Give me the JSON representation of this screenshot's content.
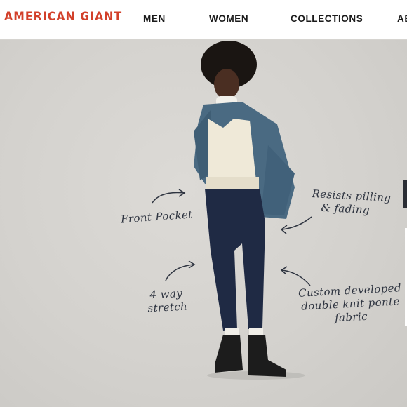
{
  "brand": {
    "logo_text": "AMERICAN GIANT",
    "accent": "#d2402a"
  },
  "nav": {
    "items": [
      {
        "label": "MEN"
      },
      {
        "label": "WOMEN"
      },
      {
        "label": "COLLECTIONS"
      },
      {
        "label": "AB"
      }
    ]
  },
  "hero": {
    "background": "#d6d4d0",
    "callouts": {
      "front_pocket": "Front Pocket",
      "resists_line1": "Resists pilling",
      "resists_line2": "& fading",
      "stretch_line1": "4 way",
      "stretch_line2": "stretch",
      "fabric_line1": "Custom developed",
      "fabric_line2": "double knit ponte",
      "fabric_line3": "fabric"
    },
    "outfit": {
      "jacket": "#4a6a82",
      "vest": "#efe9d8",
      "leggings": "#1f2a44",
      "boots": "#1c1c1c"
    }
  }
}
